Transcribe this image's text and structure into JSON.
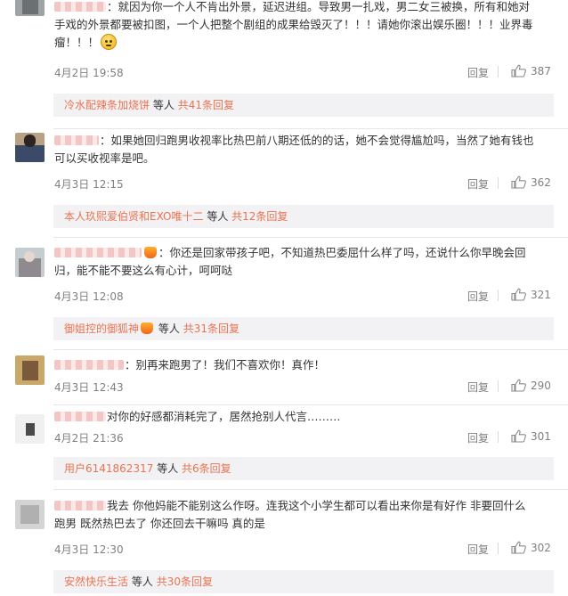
{
  "comments": [
    {
      "text_line1": "：就因为你一个人不肯出外景，延迟进组。导致男一扎戏，男二女三被换，所有和她对",
      "text_line2": "手戏的外景都要被扣图，一个人把整个剧组的成果给毁灭了！！！请她你滚出娱乐圈！！！业界毒",
      "text_line3": "瘤！！！",
      "time": "4月2日 19:58",
      "reply_label": "回复",
      "likes": "387",
      "sub": {
        "user": "冷水配辣条加烧饼",
        "mid": "等人",
        "count": "共41条回复"
      }
    },
    {
      "text_line1": "：如果她回归跑男收视率比热巴前八期还低的的话，她不会觉得尴尬吗，当然了她有钱也",
      "text_line2": "可以买收视率是吧。",
      "time": "4月3日 12:15",
      "reply_label": "回复",
      "likes": "362",
      "sub": {
        "user": "本人玖熙爱伯贤和EXO唯十二",
        "mid": "等人",
        "count": "共12条回复"
      }
    },
    {
      "text_line1": "：你还是回家带孩子吧，不知道热巴委屈什么样了吗，还说什么你早晚会回",
      "text_line2": "归，能不能不要这么有心计，呵呵哒",
      "time": "4月3日 12:08",
      "reply_label": "回复",
      "likes": "321",
      "sub": {
        "user": "御姐控的御狐神",
        "mid": "等人",
        "count": "共31条回复"
      }
    },
    {
      "text_line1": "：别再来跑男了！我们不喜欢你！真作！",
      "time": "4月3日 12:43",
      "reply_label": "回复",
      "likes": "290"
    },
    {
      "text_line1": "对你的好感都消耗完了，居然抢别人代言………",
      "time": "4月2日 21:36",
      "reply_label": "回复",
      "likes": "301",
      "sub": {
        "user": "用户6141862317",
        "mid": "等人",
        "count": "共6条回复"
      }
    },
    {
      "text_line1": "我去 你他妈能不能别这么作呀。连我这个小学生都可以看出来你是有好作 非要回什么",
      "text_line2": "跑男 既然热巴去了 你还回去干嘛吗 真的是",
      "time": "4月3日 12:30",
      "reply_label": "回复",
      "likes": "302",
      "sub": {
        "user": "安然快乐生活",
        "mid": "等人",
        "count": "共30条回复"
      }
    }
  ],
  "colors": {
    "link": "#eb7350",
    "muted": "#808080",
    "subbar_bg": "#f2f2f5"
  },
  "icons": {
    "like": "thumbs-up-icon",
    "emoji": "angry-face-emoji"
  }
}
